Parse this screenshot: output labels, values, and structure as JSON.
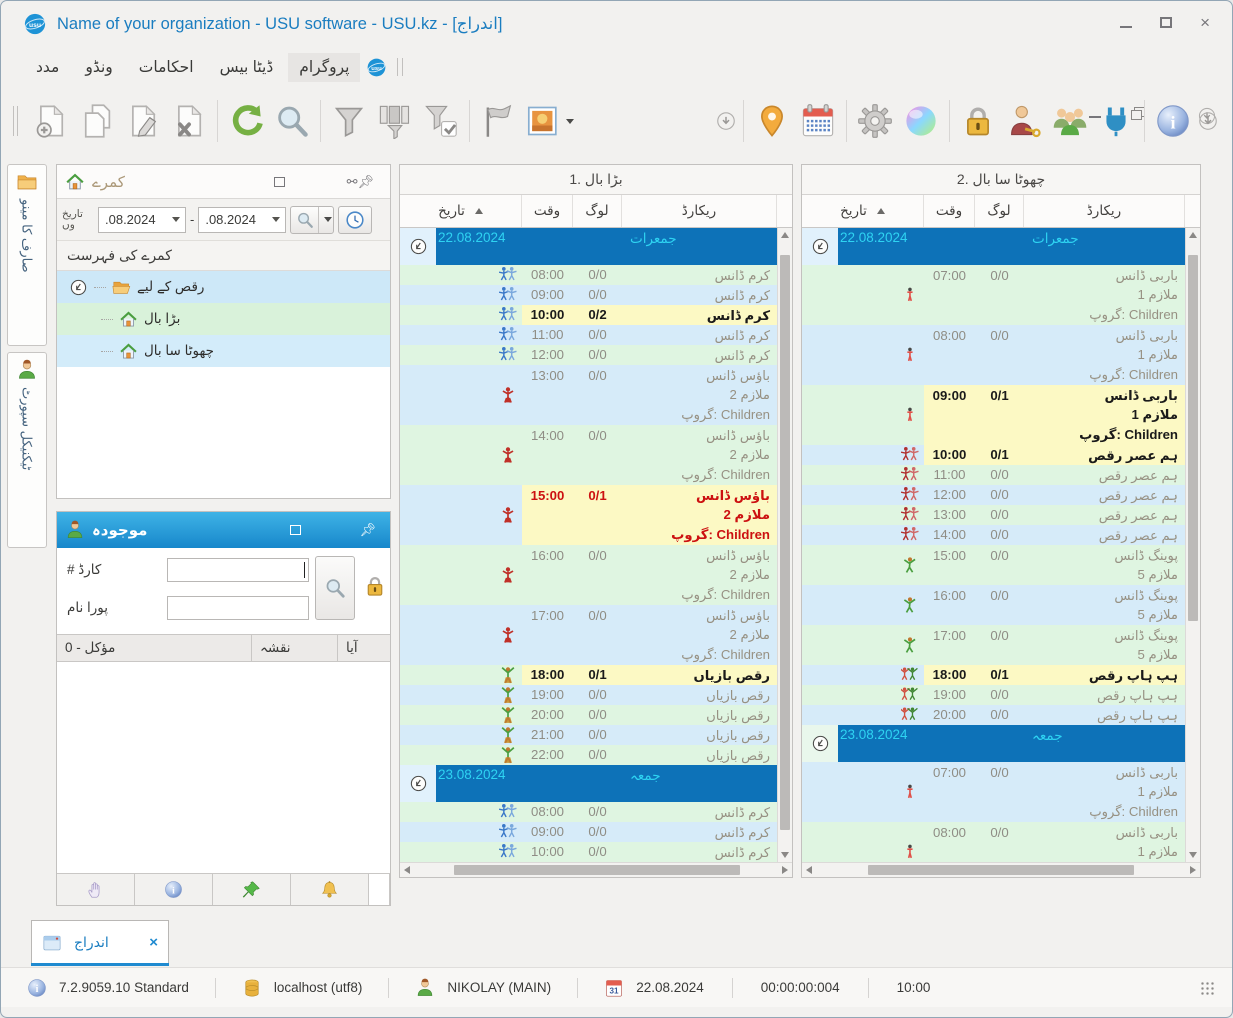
{
  "window": {
    "title": "Name of your organization - USU software - USU.kz - [اندراج]",
    "logo": "usu"
  },
  "menu": {
    "items": [
      "مدد",
      "ونڈو",
      "احکامات",
      "ڈیٹا بیس",
      "پروگرام"
    ],
    "highlighted_item": "پروگرام"
  },
  "toolbar": {
    "left_icons": [
      "new-record",
      "copy-record",
      "edit-record",
      "delete-record",
      "sep",
      "refresh",
      "search",
      "sep",
      "filter",
      "filter-panels",
      "filter-check",
      "sep",
      "flag",
      "image"
    ],
    "right_icons": [
      "location-pin",
      "calendar",
      "sep",
      "settings-gear",
      "color-ball",
      "sep",
      "lock",
      "user-key",
      "users-group",
      "plugin",
      "sep",
      "info"
    ]
  },
  "side_tabs": [
    {
      "label": "صارف کا مینو",
      "icon": "folder"
    },
    {
      "label": "ٹیکنیکل سپورٹ",
      "icon": "person"
    }
  ],
  "rooms_panel": {
    "title": "کمرے",
    "date_label_line1": "تاریخ",
    "date_label_line2": "وں",
    "date_from": ".08.2024",
    "date_to": ".08.2024",
    "list_header": "کمرے کی فہرست",
    "tree": {
      "root": "رقص کے لیے",
      "children": [
        "بڑا بال",
        "چھوٹا سا بال"
      ]
    }
  },
  "current_panel": {
    "title": "موجودہ",
    "card_label": "# کارڈ",
    "name_label": "پورا نام",
    "card_value": "",
    "name_value": "",
    "table_headers": [
      "مؤکل - 0",
      "نقشہ",
      "آیا"
    ]
  },
  "schedules": [
    {
      "title": "بڑا بال .1",
      "columns": {
        "date": "تاریخ",
        "time": "وقت",
        "people": "لوگ",
        "record": "ریکارڈ"
      },
      "vthumb": [
        0.02,
        0.93
      ],
      "groups": [
        {
          "date": "22.08.2024",
          "weekday": "جمعرات",
          "rows": [
            {
              "time": "08:00",
              "people": "0/0",
              "record": [
                "کرم ڈانس"
              ],
              "icon": "couple-blue"
            },
            {
              "time": "09:00",
              "people": "0/0",
              "record": [
                "کرم ڈانس"
              ],
              "icon": "couple-blue"
            },
            {
              "time": "10:00",
              "people": "0/2",
              "record": [
                "کرم ڈانس"
              ],
              "icon": "couple-blue",
              "highlight": "black"
            },
            {
              "time": "11:00",
              "people": "0/0",
              "record": [
                "کرم ڈانس"
              ],
              "icon": "couple-blue"
            },
            {
              "time": "12:00",
              "people": "0/0",
              "record": [
                "کرم ڈانس"
              ],
              "icon": "couple-blue"
            },
            {
              "time": "13:00",
              "people": "0/0",
              "record": [
                "باؤس ڈانس",
                "ملازم 2",
                "گروپ: Children"
              ],
              "icon": "dancer-red"
            },
            {
              "time": "14:00",
              "people": "0/0",
              "record": [
                "باؤس ڈانس",
                "ملازم 2",
                "گروپ: Children"
              ],
              "icon": "dancer-red"
            },
            {
              "time": "15:00",
              "people": "0/1",
              "record": [
                "باؤس ڈانس",
                "ملازم 2",
                "گروپ: Children"
              ],
              "icon": "dancer-red",
              "highlight": "red"
            },
            {
              "time": "16:00",
              "people": "0/0",
              "record": [
                "باؤس ڈانس",
                "ملازم 2",
                "گروپ: Children"
              ],
              "icon": "dancer-red"
            },
            {
              "time": "17:00",
              "people": "0/0",
              "record": [
                "باؤس ڈانس",
                "ملازم 2",
                "گروپ: Children"
              ],
              "icon": "dancer-red"
            },
            {
              "time": "18:00",
              "people": "0/1",
              "record": [
                "رقص بازیاں"
              ],
              "icon": "dancer-gold",
              "highlight": "black"
            },
            {
              "time": "19:00",
              "people": "0/0",
              "record": [
                "رقص بازیاں"
              ],
              "icon": "dancer-gold"
            },
            {
              "time": "20:00",
              "people": "0/0",
              "record": [
                "رقص بازیاں"
              ],
              "icon": "dancer-gold"
            },
            {
              "time": "21:00",
              "people": "0/0",
              "record": [
                "رقص بازیاں"
              ],
              "icon": "dancer-gold"
            },
            {
              "time": "22:00",
              "people": "0/0",
              "record": [
                "رقص بازیاں"
              ],
              "icon": "dancer-gold"
            }
          ]
        },
        {
          "date": "23.08.2024",
          "weekday": "جمعہ",
          "rows": [
            {
              "time": "08:00",
              "people": "0/0",
              "record": [
                "کرم ڈانس"
              ],
              "icon": "couple-blue"
            },
            {
              "time": "09:00",
              "people": "0/0",
              "record": [
                "کرم ڈانس"
              ],
              "icon": "couple-blue"
            },
            {
              "time": "10:00",
              "people": "0/0",
              "record": [
                "کرم ڈانس"
              ],
              "icon": "couple-blue"
            }
          ]
        }
      ]
    },
    {
      "title": "چھوٹا سا بال .2",
      "columns": {
        "date": "تاریخ",
        "time": "وقت",
        "people": "لوگ",
        "record": "ریکارڈ"
      },
      "vthumb": [
        0.02,
        0.6
      ],
      "groups": [
        {
          "date": "22.08.2024",
          "weekday": "جمعرات",
          "rows": [
            {
              "time": "07:00",
              "people": "0/0",
              "record": [
                "باربی ڈانس",
                "ملازم 1",
                "گروپ: Children"
              ],
              "icon": "figure-red"
            },
            {
              "time": "08:00",
              "people": "0/0",
              "record": [
                "باربی ڈانس",
                "ملازم 1",
                "گروپ: Children"
              ],
              "icon": "figure-red"
            },
            {
              "time": "09:00",
              "people": "0/1",
              "record": [
                "باربی ڈانس",
                "ملازم 1",
                "گروپ: Children"
              ],
              "icon": "figure-red",
              "highlight": "black"
            },
            {
              "time": "10:00",
              "people": "0/1",
              "record": [
                "ہم عصر رقص"
              ],
              "icon": "couple-red",
              "highlight": "black"
            },
            {
              "time": "11:00",
              "people": "0/0",
              "record": [
                "ہم عصر رقص"
              ],
              "icon": "couple-red"
            },
            {
              "time": "12:00",
              "people": "0/0",
              "record": [
                "ہم عصر رقص"
              ],
              "icon": "couple-red"
            },
            {
              "time": "13:00",
              "people": "0/0",
              "record": [
                "ہم عصر رقص"
              ],
              "icon": "couple-red"
            },
            {
              "time": "14:00",
              "people": "0/0",
              "record": [
                "ہم عصر رقص"
              ],
              "icon": "couple-red"
            },
            {
              "time": "15:00",
              "people": "0/0",
              "record": [
                "پوینگ ڈانس",
                "ملازم 5"
              ],
              "icon": "dancer-green"
            },
            {
              "time": "16:00",
              "people": "0/0",
              "record": [
                "پوینگ ڈانس",
                "ملازم 5"
              ],
              "icon": "dancer-green"
            },
            {
              "time": "17:00",
              "people": "0/0",
              "record": [
                "پوینگ ڈانس",
                "ملازم 5"
              ],
              "icon": "dancer-green"
            },
            {
              "time": "18:00",
              "people": "0/1",
              "record": [
                "ہپ ہاپ رقص"
              ],
              "icon": "duo-red-green",
              "highlight": "black"
            },
            {
              "time": "19:00",
              "people": "0/0",
              "record": [
                "ہپ ہاپ رقص"
              ],
              "icon": "duo-red-green"
            },
            {
              "time": "20:00",
              "people": "0/0",
              "record": [
                "ہپ ہاپ رقص"
              ],
              "icon": "duo-red-green"
            }
          ]
        },
        {
          "date": "23.08.2024",
          "weekday": "جمعہ",
          "rows": [
            {
              "time": "07:00",
              "people": "0/0",
              "record": [
                "باربی ڈانس",
                "ملازم 1",
                "گروپ: Children"
              ],
              "icon": "figure-red"
            },
            {
              "time": "08:00",
              "people": "0/0",
              "record": [
                "باربی ڈانس",
                "ملازم 1",
                "گروپ: Children"
              ],
              "icon": "figure-red"
            }
          ]
        }
      ]
    }
  ],
  "tab_bar": {
    "active_tab": "اندراج"
  },
  "status_bar": {
    "version": "7.2.9059.10 Standard",
    "database": "localhost (utf8)",
    "user": "NIKOLAY (MAIN)",
    "date": "22.08.2024",
    "timer": "00:00:00:004",
    "time": "10:00"
  },
  "colors": {
    "accent_blue": "#1a7dc0",
    "group_row": "#0d72b8",
    "group_text": "#2ed3f2",
    "row_green": "#dff5e1",
    "row_blue": "#d6ebf9",
    "highlight_yellow": "#fcf9c4",
    "alert_red": "#cc1111"
  }
}
